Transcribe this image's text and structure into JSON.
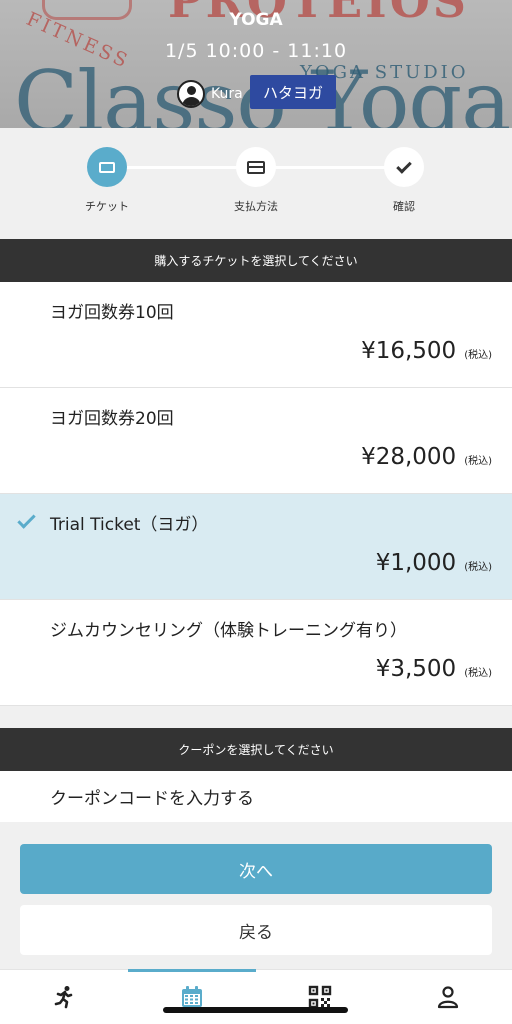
{
  "header": {
    "bg_brand_top": "PROTEIOS",
    "bg_fitness": "FITNESS",
    "bg_yoga_studio": "YOGA STUDIO",
    "bg_classo": "Classo Yoga",
    "category": "YOGA",
    "time": "1/5   10:00 - 11:10",
    "instructor": "Kura",
    "class_name": "ハタヨガ"
  },
  "stepper": {
    "steps": [
      {
        "label": "チケット",
        "icon": "ticket-icon",
        "active": true
      },
      {
        "label": "支払方法",
        "icon": "credit-card-icon",
        "active": false
      },
      {
        "label": "確認",
        "icon": "check-icon",
        "active": false
      }
    ]
  },
  "tickets": {
    "header": "購入するチケットを選択してください",
    "items": [
      {
        "name": "ヨガ回数券10回",
        "price": "¥16,500",
        "tax": "(税込)",
        "selected": false
      },
      {
        "name": "ヨガ回数券20回",
        "price": "¥28,000",
        "tax": "(税込)",
        "selected": false
      },
      {
        "name": "Trial Ticket（ヨガ）",
        "price": "¥1,000",
        "tax": "(税込)",
        "selected": true
      },
      {
        "name": "ジムカウンセリング（体験トレーニング有り）",
        "price": "¥3,500",
        "tax": "(税込)",
        "selected": false
      }
    ]
  },
  "coupon": {
    "header": "クーポンを選択してください",
    "input_label": "クーポンコードを入力する"
  },
  "buttons": {
    "next": "次へ",
    "back": "戻る"
  },
  "bottom_nav": {
    "items": [
      {
        "icon": "running-person-icon",
        "active": false
      },
      {
        "icon": "calendar-icon",
        "active": true
      },
      {
        "icon": "qr-code-icon",
        "active": false
      },
      {
        "icon": "user-icon",
        "active": false
      }
    ]
  },
  "colors": {
    "accent": "#58aac9",
    "selected_row": "#d9ebf2",
    "section_bar": "#333333",
    "badge": "#2e4aa0"
  }
}
